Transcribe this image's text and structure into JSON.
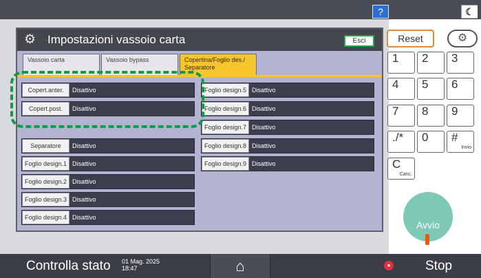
{
  "topbar": {
    "help_label": "?",
    "night_icon": "moon-icon"
  },
  "dialog": {
    "title": "Impostazioni vassoio carta",
    "exit_label": "Esci",
    "tabs": [
      {
        "label": "Vassoio carta"
      },
      {
        "label": "Vassoio bypass"
      },
      {
        "label": "Copertina/Foglio des./ Separatore"
      }
    ],
    "left_rows": [
      {
        "label": "Copert.anter.",
        "value": "Disattivo"
      },
      {
        "label": "Copert.post.",
        "value": "Disattivo"
      },
      {
        "label": "Separatore",
        "value": "Disattivo"
      },
      {
        "label": "Foglio design.1",
        "value": "Disattivo"
      },
      {
        "label": "Foglio design.2",
        "value": "Disattivo"
      },
      {
        "label": "Foglio design.3",
        "value": "Disattivo"
      },
      {
        "label": "Foglio design.4",
        "value": "Disattivo"
      }
    ],
    "right_rows": [
      {
        "label": "Foglio design.5",
        "value": "Disattivo"
      },
      {
        "label": "Foglio design.6",
        "value": "Disattivo"
      },
      {
        "label": "Foglio design.7",
        "value": "Disattivo"
      },
      {
        "label": "Foglio design.8",
        "value": "Disattivo"
      },
      {
        "label": "Foglio design.9",
        "value": "Disattivo"
      }
    ]
  },
  "keypad": {
    "reset_label": "Reset",
    "keys": [
      "1",
      "2",
      "3",
      "4",
      "5",
      "6",
      "7",
      "8",
      "9",
      "./*",
      "0",
      "#"
    ],
    "enter_sub": "Invio",
    "clear_label": "C",
    "clear_sub": "Canc.",
    "start_label": "Avvio"
  },
  "bottombar": {
    "status_label": "Controlla stato",
    "date": "01 Mag. 2025",
    "time": "18:47",
    "stop_label": "Stop"
  },
  "colors": {
    "highlight": "#119a4a",
    "active_tab": "#f7c52e",
    "reset_border": "#e08a3c"
  }
}
